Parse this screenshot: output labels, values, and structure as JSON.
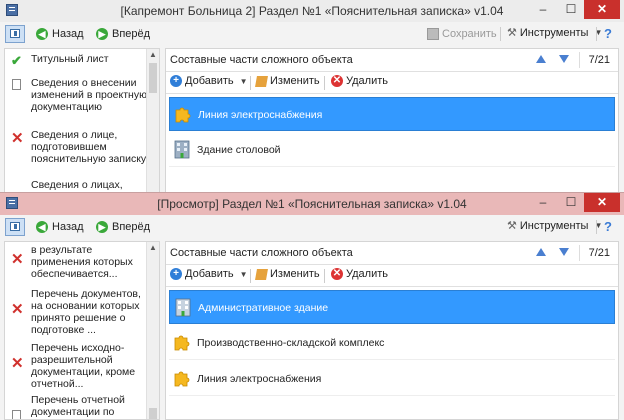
{
  "windows": [
    {
      "title": "[Капремонт Больница 2] Раздел №1 «Пояснительная записка» v1.04",
      "toolbar": {
        "back": "Назад",
        "forward": "Вперёд",
        "save": "Сохранить",
        "tools": "Инструменты",
        "help": "?"
      },
      "left_items": [
        {
          "icon": "check-icon",
          "text": "Титульный лист"
        },
        {
          "icon": "document-icon",
          "text": "Сведения о внесении изменений в проектную документацию"
        },
        {
          "icon": "cross-icon",
          "text": "Сведения о лице, подготовившем пояснительную записку"
        },
        {
          "icon": "none",
          "text": "Сведения о лицах,"
        }
      ],
      "panel": {
        "title": "Составные части сложного объекта",
        "counter": "7/21",
        "add": "Добавить",
        "edit": "Изменить",
        "delete": "Удалить",
        "rows": [
          {
            "icon": "puzzle-icon",
            "label": "Линия электроснабжения",
            "selected": true
          },
          {
            "icon": "building-icon",
            "label": "Здание столовой",
            "selected": false
          }
        ]
      }
    },
    {
      "title": "[Просмотр] Раздел №1 «Пояснительная записка» v1.04",
      "toolbar": {
        "back": "Назад",
        "forward": "Вперёд",
        "tools": "Инструменты",
        "help": "?"
      },
      "left_items": [
        {
          "icon": "cross-icon",
          "text": "в результате применения которых обеспечивается..."
        },
        {
          "icon": "cross-icon",
          "text": "Перечень документов, на основании которых принято решение о подготовке ..."
        },
        {
          "icon": "cross-icon",
          "text": "Перечень исходно-разрешительной документации, кроме отчетной..."
        },
        {
          "icon": "document-icon",
          "text": "Перечень отчетной документации по"
        }
      ],
      "panel": {
        "title": "Составные части сложного объекта",
        "counter": "7/21",
        "add": "Добавить",
        "edit": "Изменить",
        "delete": "Удалить",
        "rows": [
          {
            "icon": "building-icon",
            "label": "Административное здание",
            "selected": true
          },
          {
            "icon": "puzzle-icon",
            "label": "Производственно-складской комплекс",
            "selected": false
          },
          {
            "icon": "puzzle-icon",
            "label": "Линия электроснабжения",
            "selected": false
          }
        ]
      }
    }
  ],
  "colors": {
    "selection": "#3399ff",
    "title_active": "#e9b8b8",
    "close": "#c9302c"
  }
}
